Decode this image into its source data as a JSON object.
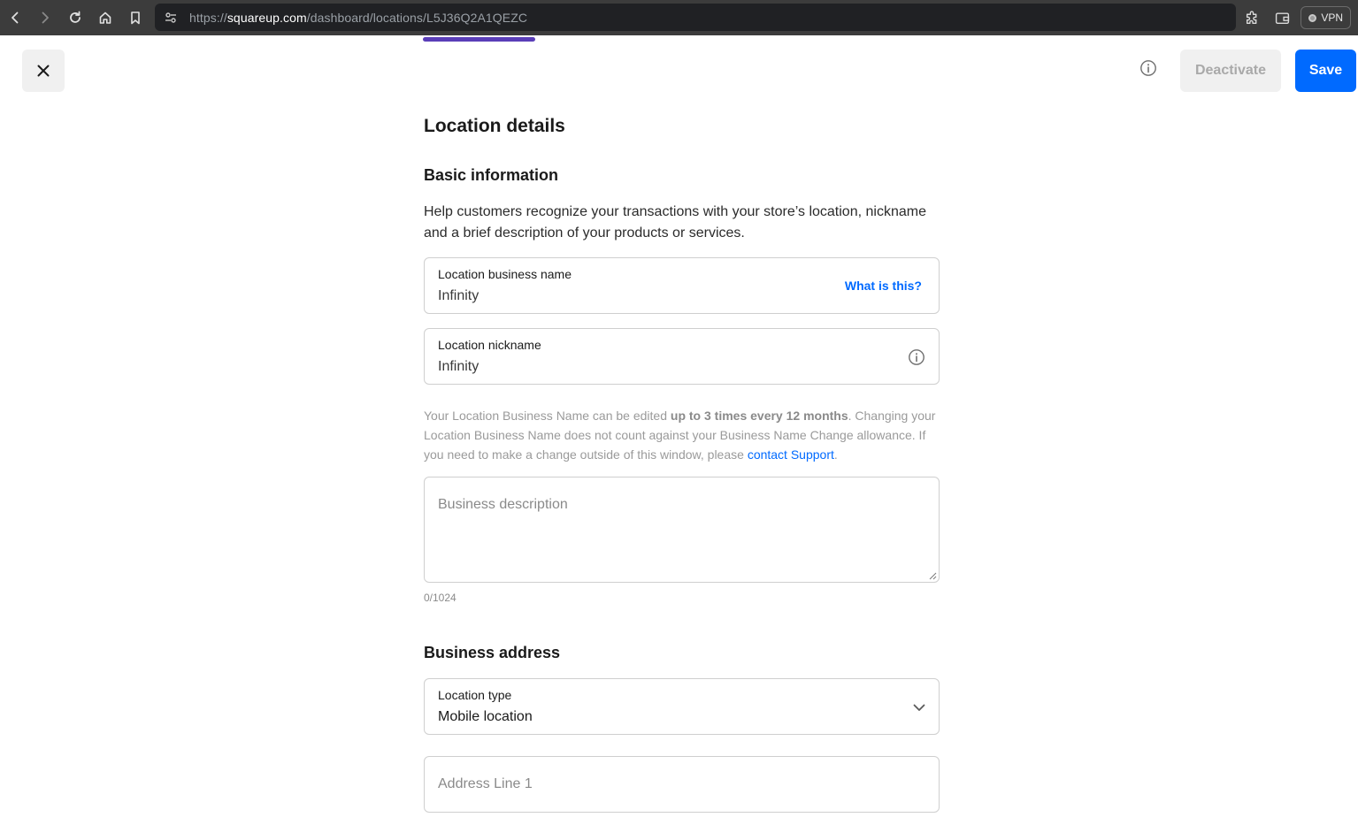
{
  "browser": {
    "url_scheme": "https://",
    "url_host": "squareup.com",
    "url_path": "/dashboard/locations/L5J36Q2A1QEZC",
    "vpn_label": "VPN"
  },
  "header": {
    "deactivate_label": "Deactivate",
    "save_label": "Save"
  },
  "page": {
    "title": "Location details",
    "basic_section_title": "Basic information",
    "basic_description": "Help customers recognize your transactions with your store’s location, nickname and a brief description of your products or services."
  },
  "fields": {
    "business_name": {
      "label": "Location business name",
      "value": "Infinity",
      "link": "What is this?"
    },
    "nickname": {
      "label": "Location nickname",
      "value": "Infinity"
    },
    "description": {
      "placeholder": "Business description",
      "counter": "0/1024"
    }
  },
  "helper": {
    "part1": "Your Location Business Name can be edited ",
    "bold": "up to 3 times every 12 months",
    "part2": ". Changing your Location Business Name does not count against your Business Name Change allowance. If you need to make a change outside of this window, please ",
    "link": "contact Support",
    "part3": "."
  },
  "address": {
    "section_title": "Business address",
    "location_type_label": "Location type",
    "location_type_value": "Mobile location",
    "address_line1_placeholder": "Address Line 1"
  },
  "colors": {
    "accent": "#006aff",
    "progress": "#5a3eb8"
  }
}
